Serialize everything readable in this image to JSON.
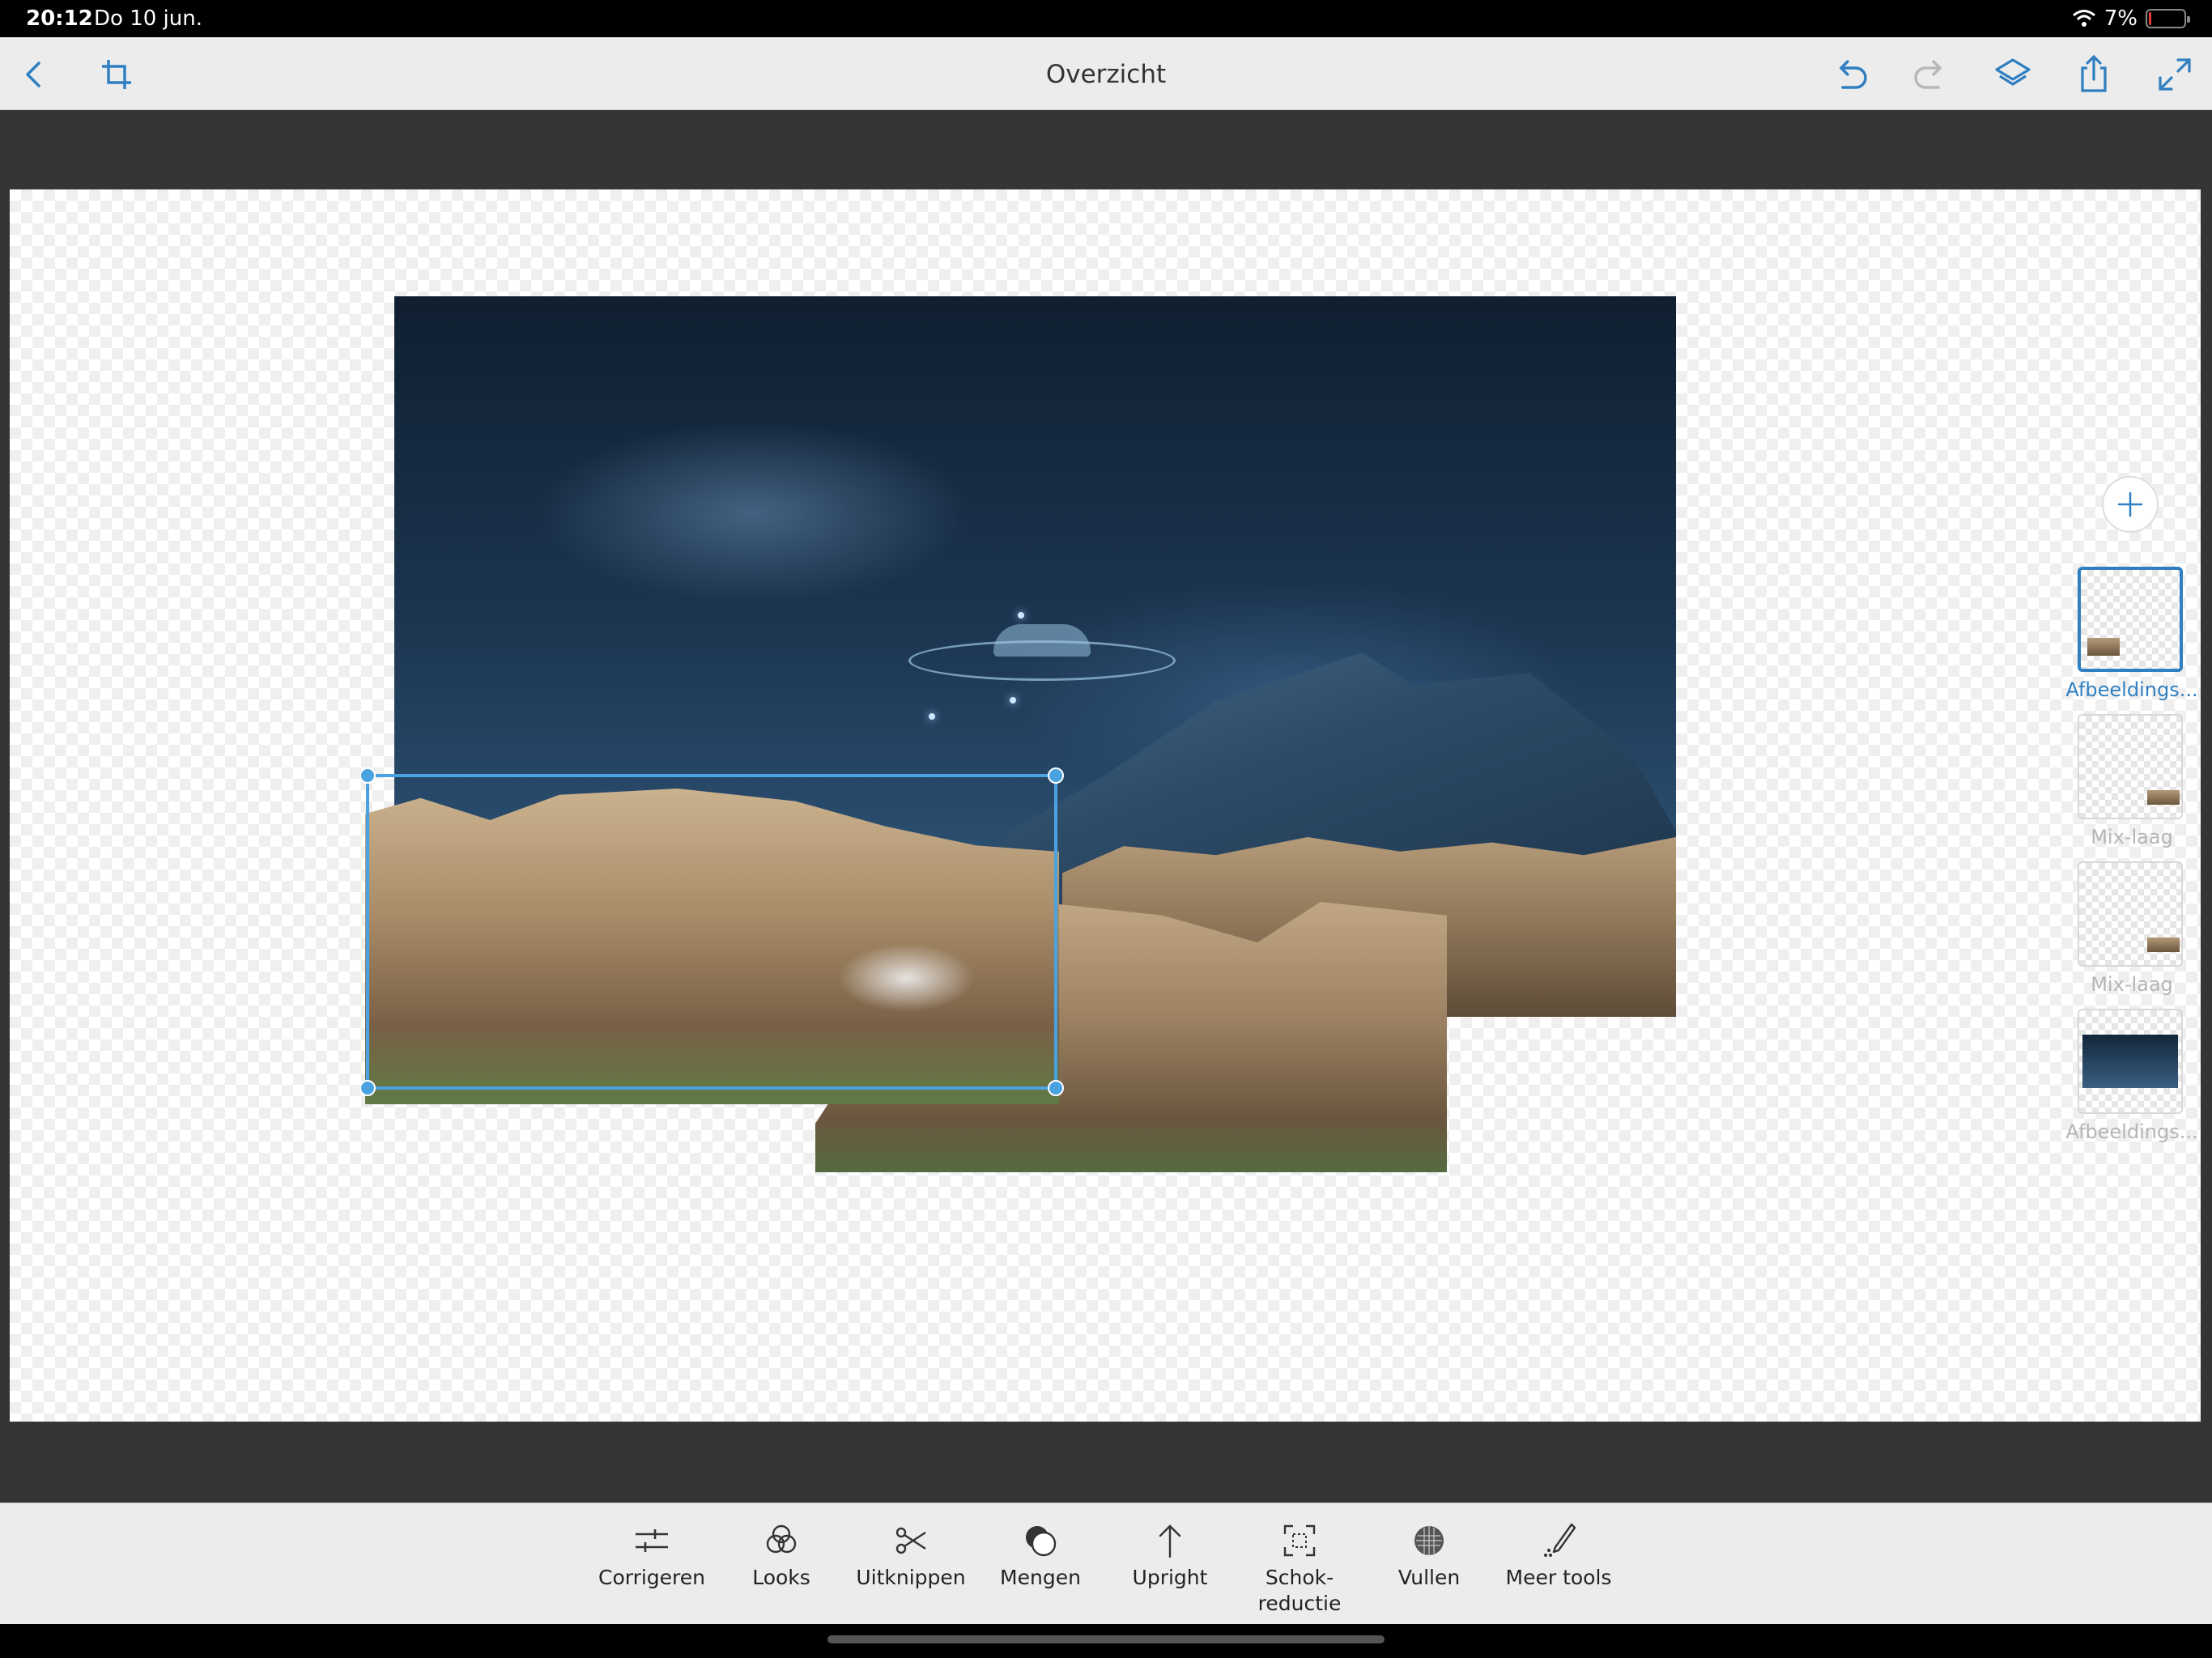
{
  "status_bar": {
    "time": "20:12",
    "date": "Do 10 jun.",
    "battery_text": "7%",
    "battery_level_percent": 7,
    "battery_color": "#e53935"
  },
  "top_bar": {
    "title": "Overzicht",
    "icons": {
      "back": "chevron-left-icon",
      "crop": "crop-icon",
      "undo": "undo-icon",
      "redo": "redo-icon",
      "layers": "layers-icon",
      "share": "share-icon",
      "fullscreen": "expand-icon"
    },
    "redo_enabled": false
  },
  "layers_panel": {
    "add_icon": "plus-icon",
    "accent_color": "#2f7fc1",
    "layers": [
      {
        "label": "Afbeeldings...",
        "active": true
      },
      {
        "label": "Mix-laag",
        "active": false
      },
      {
        "label": "Mix-laag",
        "active": false
      },
      {
        "label": "Afbeeldings...",
        "active": false
      }
    ]
  },
  "selection": {
    "color": "#4aa3e0"
  },
  "bottom_tools": [
    {
      "label": "Corrigeren",
      "icon": "sliders-icon"
    },
    {
      "label": "Looks",
      "icon": "looks-icon"
    },
    {
      "label": "Uitknippen",
      "icon": "scissors-icon"
    },
    {
      "label": "Mengen",
      "icon": "blend-icon"
    },
    {
      "label": "Upright",
      "icon": "upright-arrow-icon"
    },
    {
      "label": "Schok-\nreductie",
      "icon": "shake-reduction-icon"
    },
    {
      "label": "Vullen",
      "icon": "fill-icon"
    },
    {
      "label": "Meer tools",
      "icon": "pencil-icon"
    }
  ]
}
